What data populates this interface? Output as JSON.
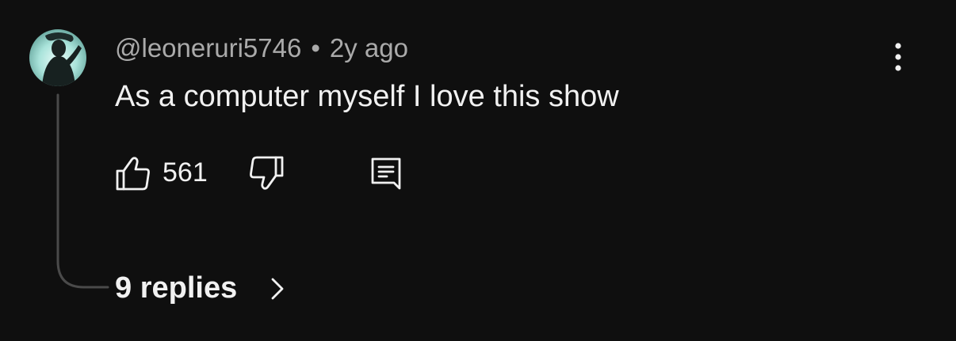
{
  "comment": {
    "author_handle": "@leoneruri5746",
    "separator": "•",
    "timestamp": "2y ago",
    "text": "As a computer myself I love this show",
    "like_count": "561",
    "replies_label": "9 replies"
  },
  "icons": {
    "like": "thumbs-up-icon",
    "dislike": "thumbs-down-icon",
    "reply": "reply-comment-icon",
    "more": "more-vertical-icon",
    "replies_chevron": "chevron-right-icon"
  },
  "colors": {
    "background": "#0f0f0f",
    "text_primary": "#f1f1f1",
    "text_secondary": "#aaaaaa",
    "thread_line": "#4a4a4a"
  }
}
